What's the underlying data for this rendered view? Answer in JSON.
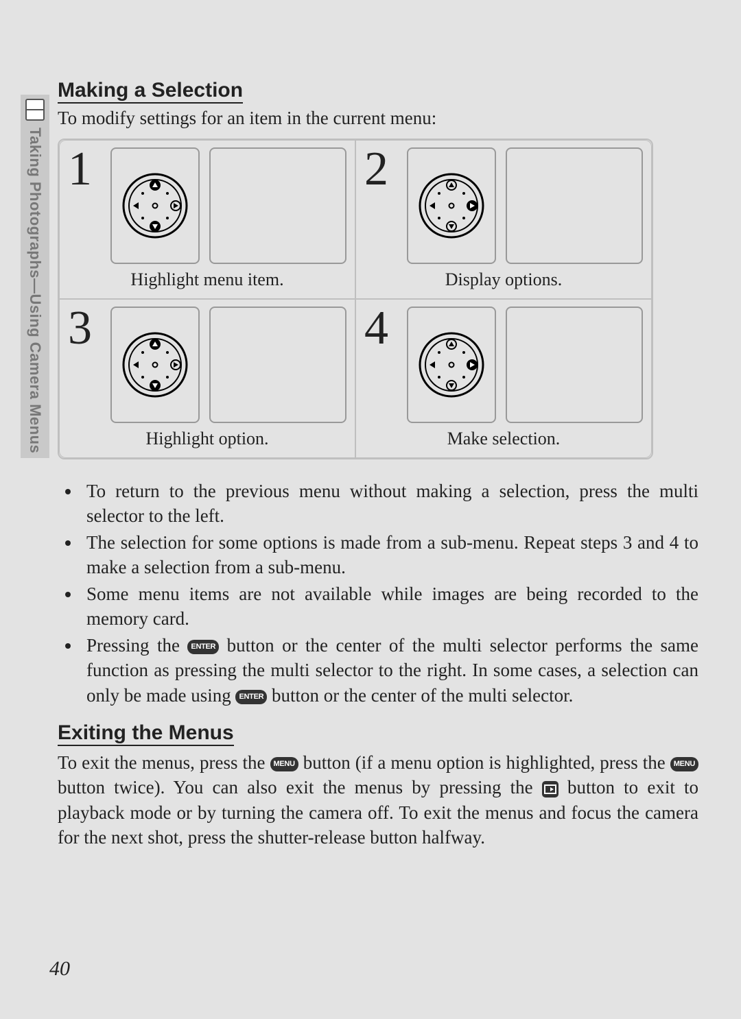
{
  "sidebar": {
    "label": "Taking Photographs—Using Camera Menus"
  },
  "section1": {
    "heading": "Making a Selection",
    "intro": "To modify settings for an item in the current menu:",
    "steps": [
      {
        "num": "1",
        "caption": "Highlight menu item.",
        "hl": "updown"
      },
      {
        "num": "2",
        "caption": "Display options.",
        "hl": "right"
      },
      {
        "num": "3",
        "caption": "Highlight option.",
        "hl": "updown"
      },
      {
        "num": "4",
        "caption": "Make selection.",
        "hl": "right"
      }
    ],
    "bullets": [
      "To return to the previous menu without making a selection, press the multi selector to the left.",
      "The selection for some options is made from a sub-menu.  Repeat steps 3 and 4 to make a selection from a sub-menu.",
      "Some menu items are not available while images are being recorded to the memory card.",
      "Pressing the {ENTER} button or the center of the multi selector performs the same function as pressing the multi selector to the right.  In some cases, a selection can only be made using {ENTER} button or the center of the multi selector."
    ]
  },
  "section2": {
    "heading": "Exiting the Menus",
    "body": "To exit the menus, press the {MENU} button (if a menu option is highlighted, press the {MENU} button twice).  You can also exit the menus by pressing the {PLAY} button to exit to playback mode or by turning the camera off.  To exit the menus and focus the camera for the next shot, press the shutter-release button halfway."
  },
  "page_number": "40",
  "icons": {
    "ENTER": "ENTER",
    "MENU": "MENU"
  }
}
